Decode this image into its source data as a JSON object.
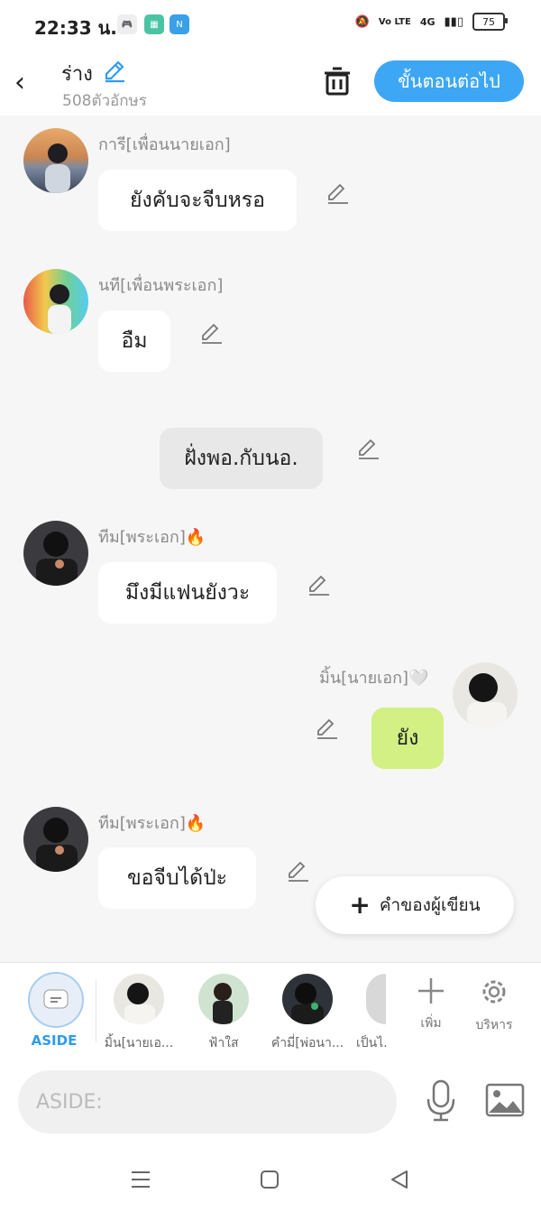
{
  "status": {
    "time": "22:33 น.",
    "battery": "75",
    "net": "4G",
    "volte": "Vo LTE"
  },
  "header": {
    "title": "ร่าง",
    "subtitle": "508ตัวอักษร",
    "next_label": "ขั้นตอนต่อไป"
  },
  "messages": [
    {
      "name": "การี[เพื่อนนายเอก]",
      "text": "ยังคับจะจีบหรอ"
    },
    {
      "name": "นที[เพื่อนพระเอก]",
      "text": "อืม"
    },
    {
      "text": "ฝั่งพอ.กับนอ."
    },
    {
      "name": "ทีม[พระเอก]🔥",
      "text": "มึงมีแฟนยังวะ"
    },
    {
      "name": "มิ้น[นายเอก]🤍",
      "text": "ยัง"
    },
    {
      "name": "ทีม[พระเอก]🔥",
      "text": "ขอจีบได้ป่ะ"
    }
  ],
  "fab": {
    "label": "คำของผู้เขียน"
  },
  "characters": {
    "aside_label": "ASIDE",
    "items": [
      "มิ้น[นายเอ...",
      "ฟ้าใส",
      "คำมี่[พ่อนา...",
      "เป็นไ..."
    ],
    "add_label": "เพิ่ม",
    "manage_label": "บริหาร"
  },
  "input": {
    "placeholder": "ASIDE:"
  },
  "colors": {
    "accent": "#3da7f5",
    "self_bubble": "#d2f084",
    "narration_bubble": "#e8e8e8"
  }
}
